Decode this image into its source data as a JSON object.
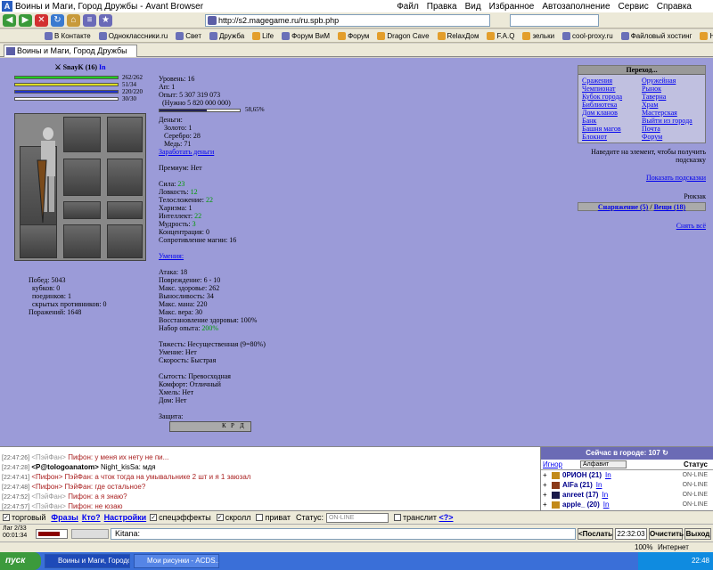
{
  "window": {
    "title": "Воины и Маги, Город Дружбы - Avant Browser",
    "menu": [
      "Файл",
      "Правка",
      "Вид",
      "Избранное",
      "Автозаполнение",
      "Сервис",
      "Справка"
    ]
  },
  "toolbar": {
    "address": "http://s2.magegame.ru/ru.spb.php"
  },
  "links": [
    {
      "label": "В Контакте",
      "icon": "vk-icon"
    },
    {
      "label": "Одноклассники.ru",
      "icon": "ok-icon"
    },
    {
      "label": "Свет",
      "icon": "page-icon"
    },
    {
      "label": "Дружба",
      "icon": "page-icon"
    },
    {
      "label": "Life",
      "icon": "folder-icon"
    },
    {
      "label": "Форум ВиМ",
      "icon": "page-icon"
    },
    {
      "label": "Форум",
      "icon": "folder-icon"
    },
    {
      "label": "Dragon Cave",
      "icon": "folder-icon"
    },
    {
      "label": "RelaxДом",
      "icon": "folder-icon"
    },
    {
      "label": "F.A.Q",
      "icon": "folder-icon"
    },
    {
      "label": "зельки",
      "icon": "folder-icon"
    },
    {
      "label": "cool-proxy.ru",
      "icon": "page-icon"
    },
    {
      "label": "Файловый хостинг",
      "icon": "page-icon"
    },
    {
      "label": "House Party",
      "icon": "folder-icon"
    }
  ],
  "tab": {
    "label": "Воины и Маги, Город Дружбы"
  },
  "character": {
    "name": "SnayK (16)",
    "in_link": "In",
    "bars": [
      {
        "value": "262/262",
        "fraction": 1.0,
        "color": "#22cc22"
      },
      {
        "value": "51/34",
        "fraction": 1.0,
        "color": "#dddd22"
      },
      {
        "value": "220/220",
        "fraction": 1.0,
        "color": "#2233cc"
      },
      {
        "value": "30/30",
        "fraction": 1.0,
        "color": "#ffffff"
      }
    ],
    "left_stats": [
      "Побед: 5043",
      "кубков: 0",
      "поединков: 1",
      "скрытых противников: 0",
      "Поражений: 1648"
    ]
  },
  "mid": {
    "level": "Уровень: 16",
    "ap": "Ап: 1",
    "exp": "Опыт: 5 307 319 073",
    "need": "(Нужно 5 820 000 000)",
    "exp_pct": "58,65%",
    "exp_fraction": 0.5865,
    "money_title": "Деньги:",
    "gold": "Золото: 1",
    "silver": "Серебро: 28",
    "copper": "Медь: 71",
    "earn_link": "Заработать деньги",
    "premium": "Премиум: Нет",
    "strength_label": "Сила:",
    "strength_val": "23",
    "agility_label": "Ловкость:",
    "agility_val": "12",
    "body_label": "Телосложение:",
    "body_val": "22",
    "charisma": "Харизма: 1",
    "intellect_label": "Интеллект:",
    "intellect_val": "22",
    "wisdom_label": "Мудрость:",
    "wisdom_val": "3",
    "concentration": "Концентрация: 0",
    "magic_resist": "Сопротивление магии: 16",
    "skills_link": "Умения:",
    "attack": "Атака: 18",
    "damage": "Повреждение: 6 - 10",
    "max_hp": "Макс. здоровье: 262",
    "stamina": "Выносливость: 34",
    "max_mana": "Макс. мана: 220",
    "max_faith": "Макс. вера: 30",
    "regen": "Восстановление здоровья: 100%",
    "exp_gain_label": "Набор опыта:",
    "exp_gain_val": "200%",
    "weight": "Тяжесть: Несущественная (9=80%)",
    "skill": "Умение: Нет",
    "speed": "Скорость: Быстрая",
    "satiety": "Сытость: Превосходная",
    "comfort": "Комфорт: Отличный",
    "drunk": "Хмель: Нет",
    "home": "Дом: Нет",
    "defense": "Защита:",
    "def_cols": [
      "К",
      "Р",
      "Д"
    ]
  },
  "nav": {
    "header": "Переход...",
    "left": [
      "Сражения",
      "Чемпионат",
      "Кубок города",
      "Библиотека",
      "Дом кланов",
      "Банк",
      "Башня магов",
      "Блокнот"
    ],
    "right": [
      "Оружейная",
      "Рынок",
      "Таверна",
      "Храм",
      "Мастерская",
      "Выйти из города",
      "Почта",
      "Форум"
    ]
  },
  "right_panel": {
    "hint": "Наведите на элемент, чтобы получить подсказку",
    "show_hints": "Показать подсказки",
    "backpack": "Рюкзак",
    "gear_link": "Снаряжение (5)",
    "sep": " / ",
    "items_link": "Вещи (18)",
    "remove_all": "Снять всё"
  },
  "chat": [
    {
      "time": "[22:47:26]",
      "from": "<ПэйФан>",
      "text": "Пифон: у меня их нету не пи..."
    },
    {
      "time": "[22:47:28]",
      "from": "<P@tologoanatom>",
      "text": "Night_kisSa: мдя"
    },
    {
      "time": "[22:47:41]",
      "from": "<Пифон>",
      "text": "ПэйФан: а чток тогда на умывальнике 2 шт и я 1 заюзал"
    },
    {
      "time": "[22:47:48]",
      "from": "<Пифон>",
      "text": "ПэйФан: где остальное?"
    },
    {
      "time": "[22:47:52]",
      "from": "<ПэйФан>",
      "text": "Пифон: а я знаю?"
    },
    {
      "time": "[22:47:57]",
      "from": "<ПэйФан>",
      "text": "Пифон: не юзаю"
    }
  ],
  "online": {
    "header": "Сейчас в городе: 107",
    "ignore": "Игнор",
    "sort": "Алфавит",
    "status": "Статус",
    "players": [
      {
        "name": "0РИОН (21)",
        "in": "In",
        "status": "ON-LINE"
      },
      {
        "name": "AlFa (21)",
        "in": "In",
        "status": "ON-LINE"
      },
      {
        "name": "anreet (17)",
        "in": "In",
        "status": "ON-LINE"
      },
      {
        "name": "apple_ (20)",
        "in": "In",
        "status": "ON-LINE"
      }
    ]
  },
  "chat_options": {
    "trade": "торговый",
    "phrases": "Фразы",
    "who": "Кто?",
    "settings": "Настройки",
    "effects": "спецэффекты",
    "scroll": "скролл",
    "private": "приват",
    "status_label": "Статус:",
    "status_value": "ON-LINE",
    "translit": "транслит",
    "translit_help": "<?>"
  },
  "input": {
    "lag": "Лаг 2/33",
    "timer": "00:01:34",
    "message": "Kitana:",
    "send": "<Послать",
    "clock": "22:32:03",
    "clear": "Очистить",
    "exit": "Выход"
  },
  "statusbar": {
    "zoom": "100%",
    "zone": "Интернет"
  },
  "taskbar": {
    "start": "пуск",
    "tasks": [
      "Воины и Маги, Городо...",
      "Мои рисунки - ACDS..."
    ],
    "clock": "22:48"
  }
}
